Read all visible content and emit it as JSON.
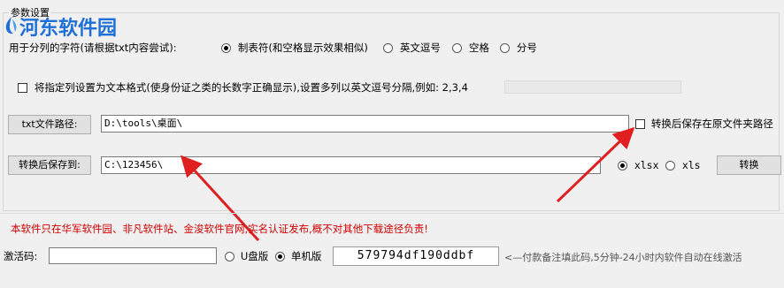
{
  "group": {
    "title": "参数设置"
  },
  "watermark": {
    "text": "河东软件园"
  },
  "delimiter": {
    "label": "用于分列的字符(请根据txt内容尝试):",
    "options": [
      {
        "label": "制表符(和空格显示效果相似)",
        "selected": true
      },
      {
        "label": "英文逗号",
        "selected": false
      },
      {
        "label": "空格",
        "selected": false
      },
      {
        "label": "分号",
        "selected": false
      }
    ]
  },
  "text_format": {
    "label": "将指定列设置为文本格式(使身份证之类的长数字正确显示),设置多列以英文逗号分隔,例如: 2,3,4",
    "checked": false,
    "value": ""
  },
  "txt_path": {
    "button": "txt文件路径:",
    "value": "D:\\tools\\桌面\\"
  },
  "save_in_source": {
    "label": "转换后保存在原文件夹路径",
    "checked": false
  },
  "save_to": {
    "button": "转换后保存到:",
    "value": "C:\\123456\\"
  },
  "format": {
    "options": [
      {
        "label": "xlsx",
        "selected": true
      },
      {
        "label": "xls",
        "selected": false
      }
    ]
  },
  "convert_button": "转换",
  "warning": "本软件只在华军软件园、非凡软件站、金浚软件官网,实名认证发布,概不对其他下载途径负责!",
  "activation": {
    "label": "激活码:",
    "value": "",
    "usb": "U盘版",
    "standalone": "单机版",
    "usb_selected": false,
    "standalone_selected": true,
    "serial": "579794df190ddbf",
    "hint": "<—付款备注填此码,5分钟-24小时内软件自动在线激活"
  },
  "colors": {
    "accent": "#1e6fd6",
    "warning": "#d00000",
    "arrow": "#e02020"
  }
}
